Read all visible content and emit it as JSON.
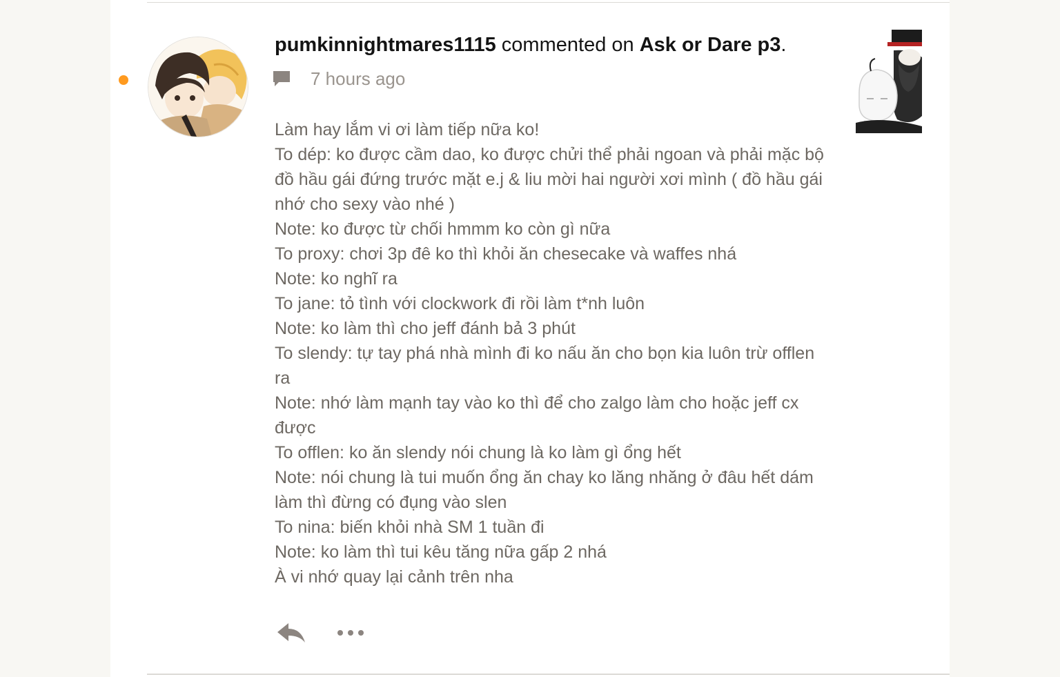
{
  "comment": {
    "username": "pumkinnightmares1115",
    "action_text": " commented on ",
    "story_title": "Ask or Dare p3",
    "period": ".",
    "timestamp": "7 hours ago",
    "unread": true,
    "body_lines": [
      "Làm hay lắm vi ơi làm tiếp nữa ko!",
      "To dép: ko được cầm dao, ko được chửi thể phải ngoan và phải mặc bộ đồ hầu gái đứng trước mặt e.j & liu mời hai người xơi mình ( đồ hầu gái nhớ cho sexy vào nhé )",
      "Note: ko được từ chối hmmm ko còn gì nữa",
      "To proxy: chơi 3p đê ko thì khỏi ăn chesecake và waffes nhá",
      "Note: ko nghĩ ra",
      "To jane: tỏ tình với clockwork đi rồi làm t*nh luôn",
      "Note: ko làm thì cho jeff đánh bả 3 phút",
      "To slendy: tự tay phá nhà mình đi ko nấu ăn cho bọn kia luôn trừ offlen ra",
      "Note: nhớ làm mạnh tay vào ko thì để cho zalgo làm cho hoặc jeff cx được",
      "To offlen: ko ăn slendy nói chung là ko làm gì ổng hết",
      "Note: nói chung là tui muốn ổng ăn chay ko lăng nhăng ở đâu hết dám làm thì đừng có đụng vào slen",
      "To nina: biến khỏi nhà SM 1 tuần đi",
      "Note: ko làm thì tui kêu tăng nữa gấp 2 nhá",
      "À vi nhớ quay lại cảnh trên nha"
    ]
  },
  "icons": {
    "meta": "comment-bubble-icon",
    "reply": "reply-arrow-icon",
    "more": "more-dots-icon"
  },
  "colors": {
    "unread_dot": "#ff9a1f",
    "body_text": "#6d6862",
    "meta_text": "#9a948e",
    "icon": "#8c8580"
  }
}
